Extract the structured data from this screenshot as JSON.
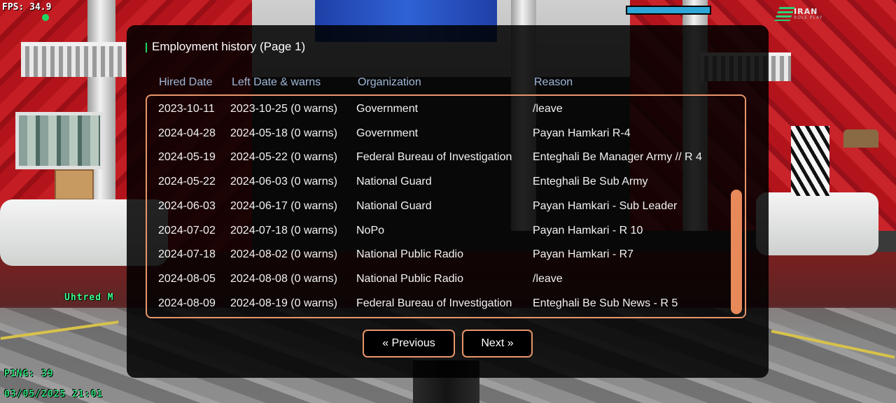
{
  "hud": {
    "fps": "FPS: 34.9",
    "player_name": "Uhtred M",
    "ping": "PING: 39",
    "datetime": "03/05/2025 21:01",
    "logo_text": "IRAN",
    "logo_sub": "ROLE PLAY"
  },
  "dialog": {
    "title": "Employment history (Page 1)",
    "columns": [
      "Hired Date",
      "Left Date & warns",
      "Organization",
      "Reason"
    ],
    "rows": [
      {
        "hired": "2023-10-11",
        "left": "2023-10-25 (0 warns)",
        "org": "Government",
        "reason": "/leave"
      },
      {
        "hired": "2024-04-28",
        "left": "2024-05-18 (0 warns)",
        "org": "Government",
        "reason": "Payan Hamkari R-4"
      },
      {
        "hired": "2024-05-19",
        "left": "2024-05-22 (0 warns)",
        "org": "Federal Bureau of Investigation",
        "reason": "Enteghali Be Manager Army // R 4"
      },
      {
        "hired": "2024-05-22",
        "left": "2024-06-03 (0 warns)",
        "org": "National Guard",
        "reason": "Enteghali Be Sub Army"
      },
      {
        "hired": "2024-06-03",
        "left": "2024-06-17 (0 warns)",
        "org": "National Guard",
        "reason": "Payan Hamkari - Sub Leader"
      },
      {
        "hired": "2024-07-02",
        "left": "2024-07-18 (0 warns)",
        "org": "NoPo",
        "reason": "Payan Hamkari - R 10"
      },
      {
        "hired": "2024-07-18",
        "left": "2024-08-02 (0 warns)",
        "org": "National Public Radio",
        "reason": "Payan Hamkari - R7"
      },
      {
        "hired": "2024-08-05",
        "left": "2024-08-08 (0 warns)",
        "org": "National Public Radio",
        "reason": "/leave"
      },
      {
        "hired": "2024-08-09",
        "left": "2024-08-19 (0 warns)",
        "org": "Federal Bureau of Investigation",
        "reason": "Enteghali Be Sub News - R 5"
      }
    ],
    "prev_label": "« Previous",
    "next_label": "Next »"
  },
  "colors": {
    "accent_orange": "#e8956a",
    "header_blue": "#9fb8d8",
    "hud_green": "#2fe07c"
  }
}
